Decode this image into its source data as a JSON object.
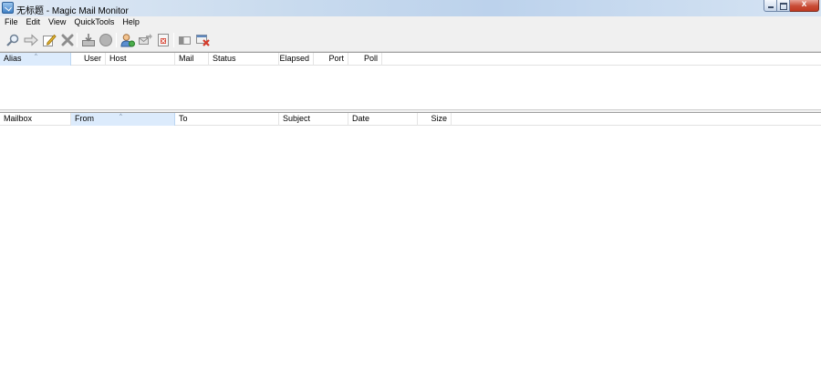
{
  "window": {
    "title": "无标题 - Magic Mail Monitor",
    "close_glyph": "x"
  },
  "menu": {
    "items": [
      "File",
      "Edit",
      "View",
      "QuickTools",
      "Help"
    ]
  },
  "toolbar": {
    "buttons": [
      {
        "name": "find-icon"
      },
      {
        "name": "forward-arrow-icon"
      },
      {
        "name": "edit-pencil-icon"
      },
      {
        "name": "delete-x-icon"
      },
      {
        "name": "inbox-tray-icon"
      },
      {
        "name": "stop-circle-icon"
      },
      {
        "name": "user-icon"
      },
      {
        "name": "mail-send-icon"
      },
      {
        "name": "page-delete-icon"
      },
      {
        "name": "preview-pane-icon"
      },
      {
        "name": "close-window-icon"
      }
    ]
  },
  "accounts_pane": {
    "sort_arrow": "^",
    "columns": [
      {
        "label": "Alias",
        "sorted": true
      },
      {
        "label": "User"
      },
      {
        "label": "Host"
      },
      {
        "label": "Mail"
      },
      {
        "label": "Status"
      },
      {
        "label": "Elapsed"
      },
      {
        "label": "Port"
      },
      {
        "label": "Poll"
      }
    ]
  },
  "messages_pane": {
    "sort_arrow": "^",
    "columns": [
      {
        "label": "Mailbox"
      },
      {
        "label": "From",
        "sorted": true
      },
      {
        "label": "To"
      },
      {
        "label": "Subject"
      },
      {
        "label": "Date"
      },
      {
        "label": "Size"
      }
    ]
  },
  "colors": {
    "sorted_header": "#dcebfc",
    "titlebar": "#c9dbee",
    "chrome": "#f0f0f0"
  }
}
